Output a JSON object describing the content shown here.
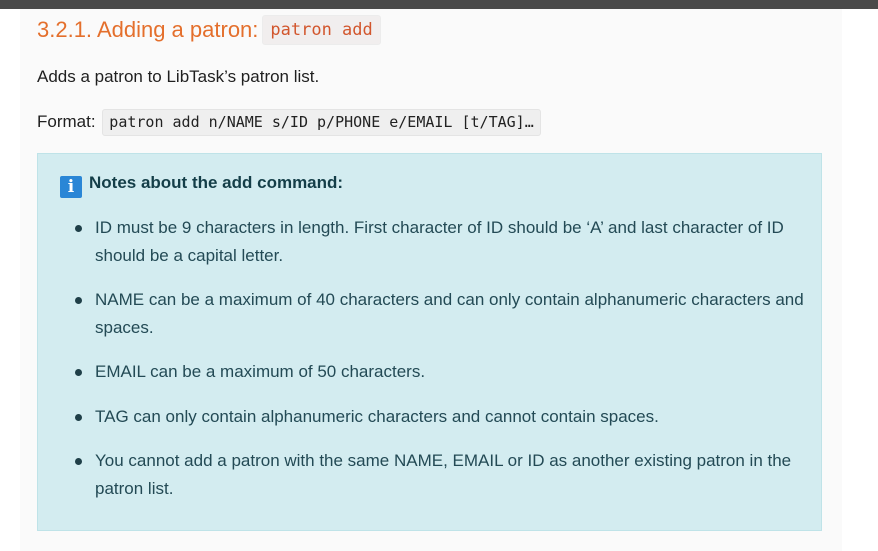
{
  "section": {
    "heading_text": "3.2.1. Adding a patron:",
    "heading_code": "patron add",
    "description": "Adds a patron to LibTask’s patron list.",
    "format_label": "Format:",
    "format_code": "patron add n/NAME s/ID p/PHONE e/EMAIL [t/TAG]…"
  },
  "note": {
    "icon": "info-icon",
    "icon_glyph": "i",
    "title": "Notes about the add command:",
    "items": [
      "ID must be 9 characters in length. First character of ID should be ‘A’ and last character of ID should be a capital letter.",
      "NAME can be a maximum of 40 characters and can only contain alphanumeric characters and spaces.",
      "EMAIL can be a maximum of 50 characters.",
      "TAG can only contain alphanumeric characters and cannot contain spaces.",
      "You cannot add a patron with the same NAME, EMAIL or ID as another existing patron in the patron list."
    ]
  },
  "colors": {
    "heading": "#e46f2c",
    "note_background": "#d3ecf0",
    "note_text": "#234a55",
    "info_icon": "#2a86d6"
  }
}
